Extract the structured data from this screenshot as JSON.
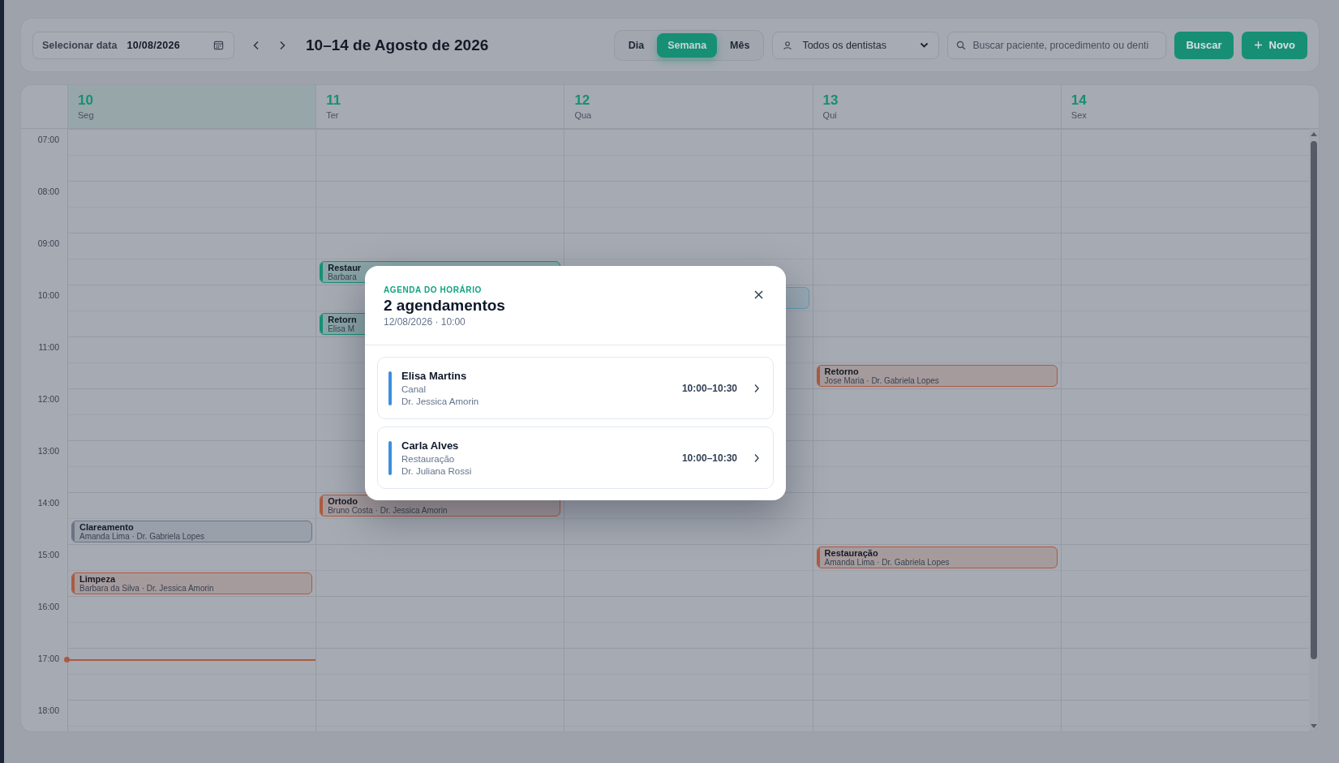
{
  "toolbar": {
    "date_label": "Selecionar data",
    "date_value": "10/08/2026",
    "range_title": "10–14 de Agosto de 2026",
    "views": [
      {
        "label": "Dia",
        "selected": false
      },
      {
        "label": "Semana",
        "selected": true
      },
      {
        "label": "Mês",
        "selected": false
      }
    ],
    "dentist_select": "Todos os dentistas",
    "search": {
      "placeholder": "Buscar paciente, procedimento ou denti"
    },
    "search_button": "Buscar",
    "new_button": "Novo"
  },
  "days": [
    {
      "number": "10",
      "weekday": "Seg",
      "selected": true
    },
    {
      "number": "11",
      "weekday": "Ter",
      "selected": false
    },
    {
      "number": "12",
      "weekday": "Qua",
      "selected": false
    },
    {
      "number": "13",
      "weekday": "Qui",
      "selected": false
    },
    {
      "number": "14",
      "weekday": "Sex",
      "selected": false
    }
  ],
  "hours": [
    {
      "label": "07:00"
    },
    {
      "label": "08:00"
    },
    {
      "label": "09:00",
      "second_half": [
        {
          "kind": "empty"
        },
        {
          "kind": "event",
          "title": "Restaur",
          "detail": "Barbara",
          "color": "#178f77"
        },
        {
          "kind": "empty"
        },
        {
          "kind": "empty"
        },
        {
          "kind": "empty"
        }
      ]
    },
    {
      "label": "10:00",
      "first_half": [
        {
          "kind": "empty"
        },
        {
          "kind": "empty"
        },
        {
          "kind": "event",
          "color": "#5f9cb0"
        },
        {
          "kind": "empty"
        },
        {
          "kind": "empty"
        }
      ],
      "second_half": [
        {
          "kind": "empty"
        },
        {
          "kind": "event",
          "title": "Retorn",
          "detail": "Elisa M",
          "color": "#178f77"
        },
        {
          "kind": "empty"
        },
        {
          "kind": "empty"
        },
        {
          "kind": "empty"
        }
      ]
    },
    {
      "label": "11:00",
      "second_half": [
        {
          "kind": "empty"
        },
        {
          "kind": "empty"
        },
        {
          "kind": "empty"
        },
        {
          "kind": "event",
          "title": "Retorno",
          "detail": "Jose Maria · Dr. Gabriela Lopes",
          "color": "#ab5a42"
        },
        {
          "kind": "empty"
        }
      ]
    },
    {
      "label": "12:00"
    },
    {
      "label": "13:00"
    },
    {
      "label": "14:00",
      "first_half": [
        {
          "kind": "empty"
        },
        {
          "kind": "event",
          "title": "Ortodo",
          "detail": "Bruno Costa · Dr. Jessica Amorin",
          "color": "#ab5a42"
        },
        {
          "kind": "empty"
        },
        {
          "kind": "empty"
        },
        {
          "kind": "empty"
        }
      ],
      "second_half": [
        {
          "kind": "event",
          "title": "Clareamento",
          "detail": "Amanda Lima · Dr. Gabriela Lopes",
          "color": "#6b7385"
        },
        {
          "kind": "empty"
        },
        {
          "kind": "empty"
        },
        {
          "kind": "empty"
        },
        {
          "kind": "empty"
        }
      ]
    },
    {
      "label": "15:00",
      "first_half": [
        {
          "kind": "empty"
        },
        {
          "kind": "empty"
        },
        {
          "kind": "empty"
        },
        {
          "kind": "event",
          "title": "Restauração",
          "detail": "Amanda Lima · Dr. Gabriela Lopes",
          "color": "#ab5a42"
        },
        {
          "kind": "empty"
        }
      ],
      "second_half": [
        {
          "kind": "event",
          "title": "Limpeza",
          "detail": "Barbara da Silva · Dr. Jessica Amorin",
          "color": "#ab5a42"
        },
        {
          "kind": "empty"
        },
        {
          "kind": "empty"
        },
        {
          "kind": "empty"
        },
        {
          "kind": "empty"
        }
      ]
    },
    {
      "label": "16:00"
    },
    {
      "label": "17:00",
      "first_half": [
        {
          "kind": "now"
        },
        {
          "kind": "empty"
        },
        {
          "kind": "empty"
        },
        {
          "kind": "empty"
        },
        {
          "kind": "empty"
        }
      ]
    },
    {
      "label": "18:00"
    }
  ],
  "modal": {
    "eyebrow": "AGENDA DO HORÁRIO",
    "title": "2 agendamentos",
    "subtitle": "12/08/2026 · 10:00",
    "appointments": [
      {
        "patient": "Elisa Martins",
        "procedure": "Canal",
        "dentist": "Dr. Jessica Amorin",
        "time": "10:00–10:30",
        "color": "#3b8fdf"
      },
      {
        "patient": "Carla Alves",
        "procedure": "Restauração",
        "dentist": "Dr. Juliana Rossi",
        "time": "10:00–10:30",
        "color": "#3b8fdf"
      }
    ]
  }
}
